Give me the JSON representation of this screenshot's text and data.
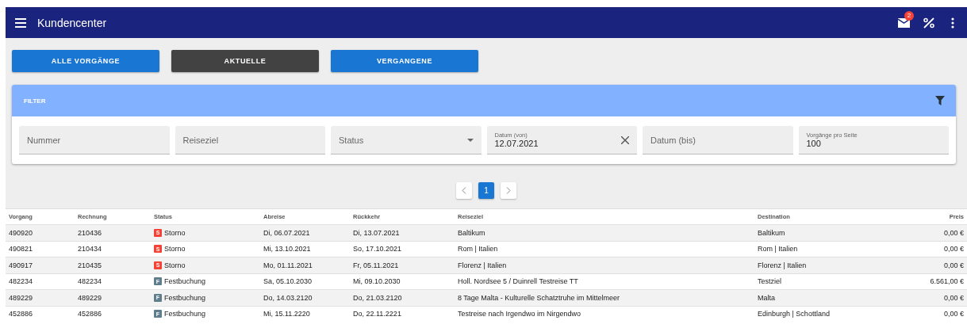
{
  "app_bar": {
    "title": "Kundencenter",
    "mail_badge": "2"
  },
  "view_buttons": [
    {
      "label": "ALLE VORGÄNGE",
      "selected": false
    },
    {
      "label": "AKTUELLE",
      "selected": true
    },
    {
      "label": "VERGANGENE",
      "selected": false
    }
  ],
  "filter": {
    "title": "FILTER",
    "fields": [
      {
        "kind": "text",
        "placeholder": "Nummer"
      },
      {
        "kind": "text",
        "placeholder": "Reiseziel"
      },
      {
        "kind": "select",
        "placeholder": "Status"
      },
      {
        "kind": "clearable",
        "label": "Datum (von)",
        "value": "12.07.2021"
      },
      {
        "kind": "text",
        "placeholder": "Datum (bis)"
      },
      {
        "kind": "labeled",
        "label": "Vorgänge pro Seite",
        "value": "100"
      }
    ]
  },
  "pagination": {
    "pages": [
      {
        "label": "1",
        "selected": true
      }
    ]
  },
  "table": {
    "columns": [
      "Vorgang",
      "Rechnung",
      "Status",
      "Abreise",
      "Rückkehr",
      "Reiseziel",
      "Destination",
      "Preis"
    ],
    "rows": [
      {
        "vorgang": "490920",
        "rechnung": "210436",
        "status": {
          "letter": "S",
          "label": "Storno",
          "color": "#f44336"
        },
        "abreise": "Di, 06.07.2021",
        "rueckkehr": "Di, 13.07.2021",
        "reiseziel": "Baltikum",
        "destination": "Baltikum",
        "preis": "0,00 €"
      },
      {
        "vorgang": "490821",
        "rechnung": "210434",
        "status": {
          "letter": "S",
          "label": "Storno",
          "color": "#f44336"
        },
        "abreise": "Mi, 13.10.2021",
        "rueckkehr": "So, 17.10.2021",
        "reiseziel": "Rom | Italien",
        "destination": "Rom | Italien",
        "preis": "0,00 €"
      },
      {
        "vorgang": "490917",
        "rechnung": "210435",
        "status": {
          "letter": "S",
          "label": "Storno",
          "color": "#f44336"
        },
        "abreise": "Mo, 01.11.2021",
        "rueckkehr": "Fr, 05.11.2021",
        "reiseziel": "Florenz | Italien",
        "destination": "Florenz | Italien",
        "preis": "0,00 €"
      },
      {
        "vorgang": "482234",
        "rechnung": "482234",
        "status": {
          "letter": "F",
          "label": "Festbuchung",
          "color": "#607d8b"
        },
        "abreise": "Sa, 05.10.2030",
        "rueckkehr": "Mi, 09.10.2030",
        "reiseziel": "Holl. Nordsee 5 / Duinrell Testreise TT",
        "destination": "Testziel",
        "preis": "6.561,00 €"
      },
      {
        "vorgang": "489229",
        "rechnung": "489229",
        "status": {
          "letter": "F",
          "label": "Festbuchung",
          "color": "#607d8b"
        },
        "abreise": "Do, 14.03.2120",
        "rueckkehr": "Do, 21.03.2120",
        "reiseziel": "8 Tage Malta - Kulturelle Schatztruhe im Mittelmeer",
        "destination": "Malta",
        "preis": "0,00 €"
      },
      {
        "vorgang": "452886",
        "rechnung": "452886",
        "status": {
          "letter": "F",
          "label": "Festbuchung",
          "color": "#607d8b"
        },
        "abreise": "Mi, 15.11.2220",
        "rueckkehr": "Do, 22.11.2221",
        "reiseziel": "Testreise nach Irgendwo im Nirgendwo",
        "destination": "Edinburgh | Schottland",
        "preis": "0,00 €"
      }
    ]
  }
}
